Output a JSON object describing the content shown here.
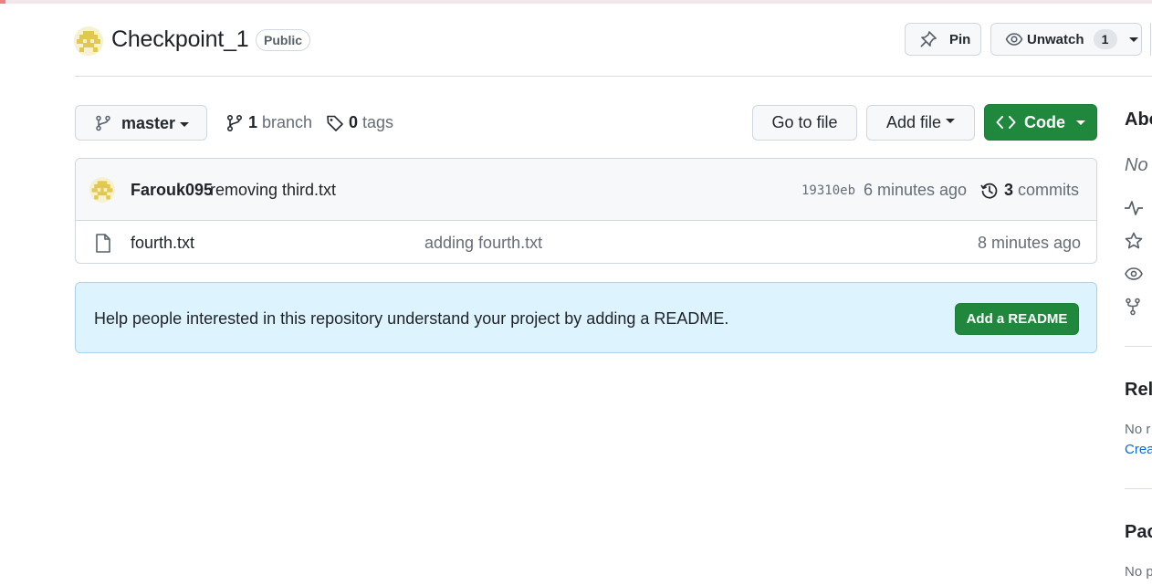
{
  "repo": {
    "name": "Checkpoint_1",
    "visibility": "Public",
    "avatar_icon": "identicon-avatar"
  },
  "header_actions": {
    "pin_label": "Pin",
    "unwatch_label": "Unwatch",
    "watch_count": "1"
  },
  "controls": {
    "branch_name": "master",
    "branch_count": "1",
    "branch_word": "branch",
    "tag_count": "0",
    "tag_word": "tags",
    "go_to_file": "Go to file",
    "add_file": "Add file",
    "code": "Code"
  },
  "latest_commit": {
    "author": "Farouk095",
    "message": "removing third.txt",
    "sha": "19310eb",
    "time": "6 minutes ago",
    "commit_count": "3",
    "commit_word": "commits"
  },
  "files": [
    {
      "name": "fourth.txt",
      "message": "adding fourth.txt",
      "time": "8 minutes ago"
    }
  ],
  "readme_banner": {
    "text": "Help people interested in this repository understand your project by adding a README.",
    "button": "Add a README"
  },
  "sidebar": {
    "about_heading": "Abo",
    "about_text": "No",
    "releases_heading": "Rele",
    "releases_text": "No r",
    "releases_link": "Crea",
    "packages_heading": "Pac",
    "packages_text": "No p"
  },
  "colors": {
    "primary_green": "#1f883d",
    "banner_blue": "#ddf4ff",
    "link_blue": "#0969da",
    "avatar_yellow": "#e2c84f"
  }
}
